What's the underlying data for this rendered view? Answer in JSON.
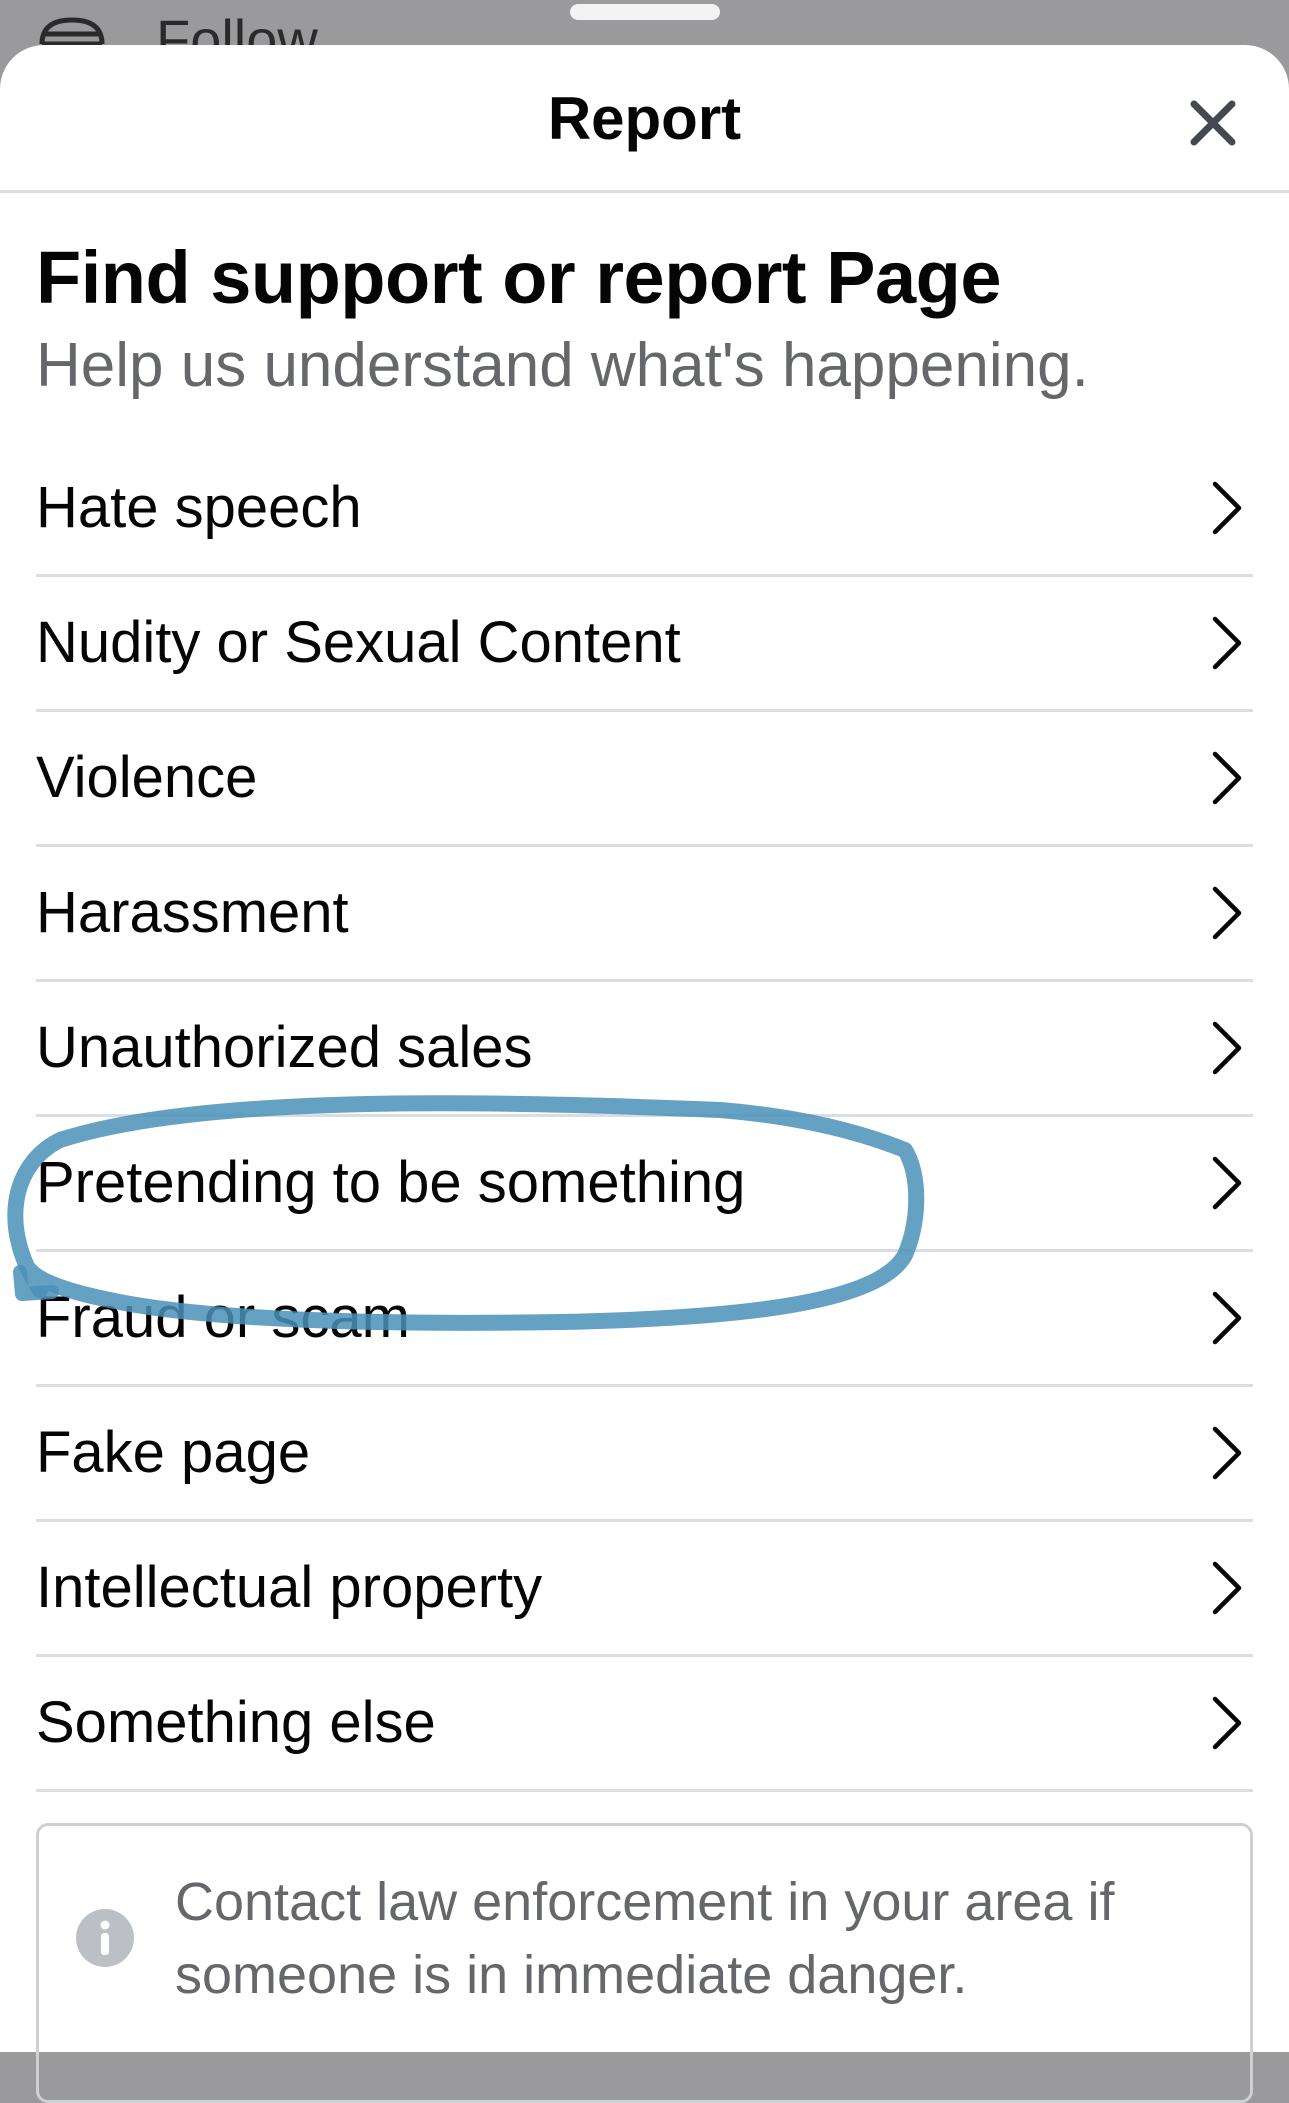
{
  "background": {
    "partial_text": "Follow"
  },
  "dialog": {
    "title": "Report"
  },
  "content": {
    "heading": "Find support or report Page",
    "subheading": "Help us understand what's happening."
  },
  "options": [
    {
      "label": "Hate speech"
    },
    {
      "label": "Nudity or Sexual Content"
    },
    {
      "label": "Violence"
    },
    {
      "label": "Harassment"
    },
    {
      "label": "Unauthorized sales"
    },
    {
      "label": "Pretending to be something"
    },
    {
      "label": "Fraud or scam"
    },
    {
      "label": "Fake page"
    },
    {
      "label": "Intellectual property"
    },
    {
      "label": "Something else"
    }
  ],
  "notice": {
    "text": "Contact law enforcement in your area if someone is in immediate danger."
  },
  "colors": {
    "text_primary": "#050505",
    "text_secondary": "#65676b",
    "divider": "#dadde1",
    "annotation_stroke": "#4a90b8",
    "overlay": "#9a9a9c"
  },
  "icons": {
    "close": "close-icon",
    "chevron": "chevron-right-icon",
    "info": "info-icon",
    "follow": "follow-icon"
  }
}
